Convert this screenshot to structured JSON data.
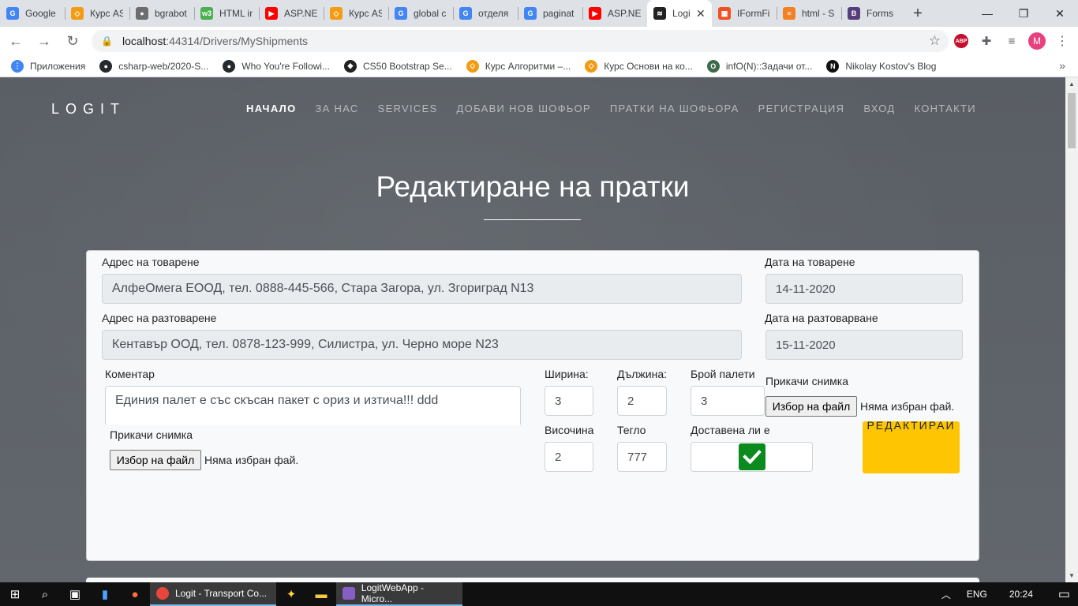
{
  "browser": {
    "tabs": [
      {
        "label": "Google",
        "color": "#4285f4",
        "glyph": "G"
      },
      {
        "label": "Курс AS",
        "color": "#f39c12",
        "glyph": "◇"
      },
      {
        "label": "bgrabot",
        "color": "#6d6d6d",
        "glyph": "●"
      },
      {
        "label": "HTML in",
        "color": "#4caf50",
        "glyph": "w3"
      },
      {
        "label": "ASP.NE",
        "color": "#ff0000",
        "glyph": "▶"
      },
      {
        "label": "Курс AS",
        "color": "#f39c12",
        "glyph": "◇"
      },
      {
        "label": "global c",
        "color": "#4285f4",
        "glyph": "G"
      },
      {
        "label": "отделя",
        "color": "#4285f4",
        "glyph": "G"
      },
      {
        "label": "paginat",
        "color": "#4285f4",
        "glyph": "G"
      },
      {
        "label": "ASP.NE",
        "color": "#ff0000",
        "glyph": "▶"
      },
      {
        "label": "Logi",
        "color": "#222222",
        "glyph": "≋",
        "active": true
      },
      {
        "label": "IFormFi",
        "color": "#f25022",
        "glyph": "▦"
      },
      {
        "label": "html - S",
        "color": "#f48024",
        "glyph": "≡"
      },
      {
        "label": "Forms",
        "color": "#563d7c",
        "glyph": "B"
      }
    ],
    "new_tab": "+",
    "window_controls": [
      "—",
      "❐",
      "✕"
    ],
    "url_host": "localhost",
    "url_rest": ":44314/Drivers/MyShipments",
    "profile_initial": "M",
    "abp_label": "ABP",
    "bookmarks": [
      {
        "label": "Приложения",
        "color": "#4285f4",
        "glyph": "⋮"
      },
      {
        "label": "csharp-web/2020-S...",
        "color": "#24292e",
        "glyph": "●"
      },
      {
        "label": "Who You're Followi...",
        "color": "#24292e",
        "glyph": "●"
      },
      {
        "label": "CS50 Bootstrap Se...",
        "color": "#222222",
        "glyph": "◆"
      },
      {
        "label": "Курс Алгоритми –...",
        "color": "#f39c12",
        "glyph": "◇"
      },
      {
        "label": "Курс Основи на ко...",
        "color": "#f39c12",
        "glyph": "◇"
      },
      {
        "label": "infO(N)::Задачи от...",
        "color": "#3d6b4a",
        "glyph": "O"
      },
      {
        "label": "Nikolay Kostov's Blog",
        "color": "#111111",
        "glyph": "N"
      }
    ]
  },
  "site": {
    "brand": "LOGIT",
    "nav": [
      {
        "label": "НАЧАЛО",
        "active": true
      },
      {
        "label": "ЗА НАС"
      },
      {
        "label": "SERVICES"
      },
      {
        "label": "ДОБАВИ НОВ ШОФЬОР"
      },
      {
        "label": "ПРАТКИ НА ШОФЬОРА"
      },
      {
        "label": "РЕГИСТРАЦИЯ"
      },
      {
        "label": "ВХОД"
      },
      {
        "label": "КОНТАКТИ"
      }
    ],
    "heading": "Редактиране на пратки"
  },
  "form": {
    "loading_address_label": "Адрес на товарене",
    "loading_address_value": "АлфеОмега ЕООД, тел. 0888-445-566, Стара Загора, ул. Згориград N13",
    "loading_date_label": "Дата на товарене",
    "loading_date_value": "14-11-2020",
    "unloading_address_label": "Адрес на разтоварене",
    "unloading_address_value": "Кентавър ООД, тел. 0878-123-999, Силистра, ул. Черно море N23",
    "unloading_date_label": "Дата на разтоварване",
    "unloading_date_value": "15-11-2020",
    "comment_label": "Коментар",
    "comment_value": "Единия палет е със скъсан пакет с ориз и изтича!!! ddd",
    "width_label": "Ширина:",
    "width_value": "3",
    "length_label": "Дължина:",
    "length_value": "2",
    "pallets_label": "Брой палети",
    "pallets_value": "3",
    "height_label": "Височина",
    "height_value": "2",
    "weight_label": "Тегло",
    "weight_value": "777",
    "delivered_label": "Доставена ли е",
    "delivered": true,
    "attach_label": "Прикачи снимка",
    "file_button": "Избор на файл",
    "no_file": "Няма избран фай.",
    "edit_button": "РЕДАКТИРАЙ"
  },
  "taskbar": {
    "apps": [
      {
        "label": "Logit - Transport Co...",
        "color": "#e8453c",
        "active": true
      },
      {
        "label": "LogitWebApp - Micro...",
        "color": "#865fc5",
        "active": true
      }
    ],
    "lang": "ENG",
    "time": "20:24"
  }
}
